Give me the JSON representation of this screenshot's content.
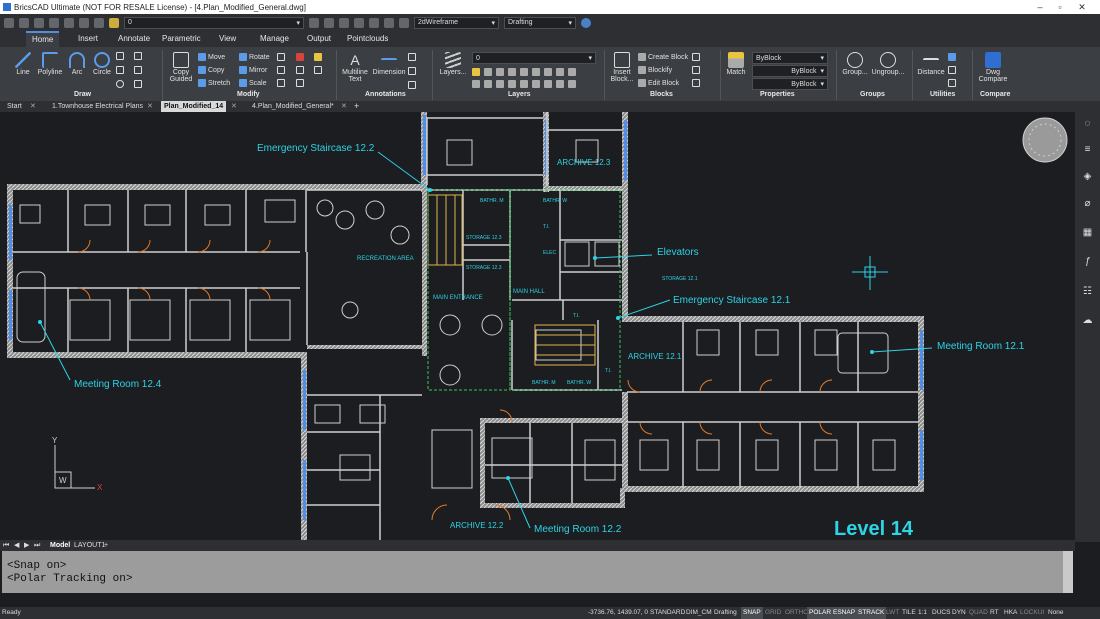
{
  "app": {
    "title": "BricsCAD Ultimate (NOT FOR RESALE License) - [4.Plan_Modified_General.dwg]"
  },
  "qat": {
    "layer": "0",
    "visualstyle": "2dWireframe",
    "workspace": "Drafting"
  },
  "ribbon_tabs": [
    "Home",
    "Insert",
    "Annotate",
    "Parametric",
    "View",
    "Manage",
    "Output",
    "Pointclouds"
  ],
  "ribbon": {
    "draw": {
      "line": "Line",
      "polyline": "Polyline",
      "arc": "Arc",
      "circle": "Circle",
      "label": "Draw"
    },
    "modify": {
      "copy_guided": "Copy Guided",
      "move": "Move",
      "copy": "Copy",
      "stretch": "Stretch",
      "rotate": "Rotate",
      "mirror": "Mirror",
      "scale": "Scale",
      "label": "Modify"
    },
    "annotations": {
      "mtext": "Multiline Text",
      "dimension": "Dimension",
      "label": "Annotations"
    },
    "layers": {
      "layers": "Layers...",
      "current": "0",
      "label": "Layers"
    },
    "blocks": {
      "insert": "Insert Block...",
      "create": "Create Block",
      "blockify": "Blockify",
      "edit": "Edit Block",
      "label": "Blocks"
    },
    "properties": {
      "match": "Match",
      "bylayer1": "ByBlock",
      "bylayer2": "ByBlock",
      "bylayer3": "ByBlock",
      "label": "Properties"
    },
    "groups": {
      "group": "Group...",
      "ungroup": "Ungroup...",
      "label": "Groups"
    },
    "utilities": {
      "distance": "Distance",
      "label": "Utilities"
    },
    "compare": {
      "dwg": "Dwg Compare",
      "label": "Compare"
    }
  },
  "doc_tabs": [
    "Start",
    "1.Townhouse Electrical Plans",
    "Plan_Modified_14",
    "4.Plan_Modified_General*"
  ],
  "drawing": {
    "labels": {
      "stair122": "Emergency Staircase 12.2",
      "archive123": "ARCHIVE 12.3",
      "elevators": "Elevators",
      "stair121": "Emergency Staircase 12.1",
      "meeting121": "Meeting Room 12.1",
      "meeting124": "Meeting Room 12.4",
      "meeting122": "Meeting Room 12.2",
      "archive121": "ARCHIVE 12.1",
      "archive122": "ARCHIVE 12.2",
      "recreation": "RECREATION AREA",
      "main_entrance": "MAIN ENTRANCE",
      "main_hall": "MAIN HALL",
      "storage123a": "STORAGE 12.3",
      "storage123b": "STORAGE 12.3",
      "storage121": "STORAGE 12.1",
      "bathm_top": "BATHR. M",
      "bathw_top": "BATHR. W",
      "bathm_bot": "BATHR. M",
      "bathw_bot": "BATHR. W",
      "ti1": "T.I.",
      "ti2": "T.I.",
      "ti3": "T.I.",
      "elec": "ELEC",
      "level": "Level 14"
    },
    "ucs": {
      "y": "Y",
      "x": "X",
      "w": "W"
    }
  },
  "layout_tabs": {
    "model": "Model",
    "layout1": "LAYOUT1"
  },
  "command": {
    "lines": [
      "<Snap on>",
      "<Polar Tracking on>"
    ]
  },
  "status": {
    "ready": "Ready",
    "coords": "-3736.76, 1439.07, 0",
    "items": [
      "STANDARD",
      "DIM_CM",
      "Drafting",
      "SNAP",
      "GRID",
      "ORTHO",
      "POLAR",
      "ESNAP",
      "STRACK",
      "LWT",
      "TILE",
      "1:1",
      "DUCS",
      "DYN",
      "QUAD",
      "RT",
      "HKA",
      "LOCKUI",
      "None"
    ]
  },
  "colors": {
    "accent": "#2e6fd1",
    "cyan": "#2ed3e6",
    "wall": "#c8c8c8"
  }
}
